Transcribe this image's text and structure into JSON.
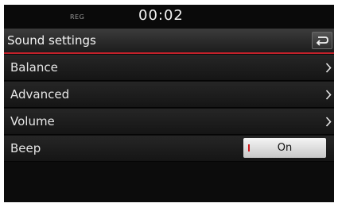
{
  "status": {
    "reg": "REG",
    "time": "00:02"
  },
  "header": {
    "title": "Sound settings",
    "back_icon": "back-arrow-icon"
  },
  "menu": [
    {
      "label": "Balance",
      "icon": "chevron-right-icon"
    },
    {
      "label": "Advanced",
      "icon": "chevron-right-icon"
    },
    {
      "label": "Volume",
      "icon": "chevron-right-icon"
    },
    {
      "label": "Beep",
      "toggle": {
        "value": "On",
        "state": true
      }
    }
  ],
  "colors": {
    "accent": "#c4212a",
    "background": "#0c0c0c",
    "toggle_bg": "#e6e6e6"
  }
}
